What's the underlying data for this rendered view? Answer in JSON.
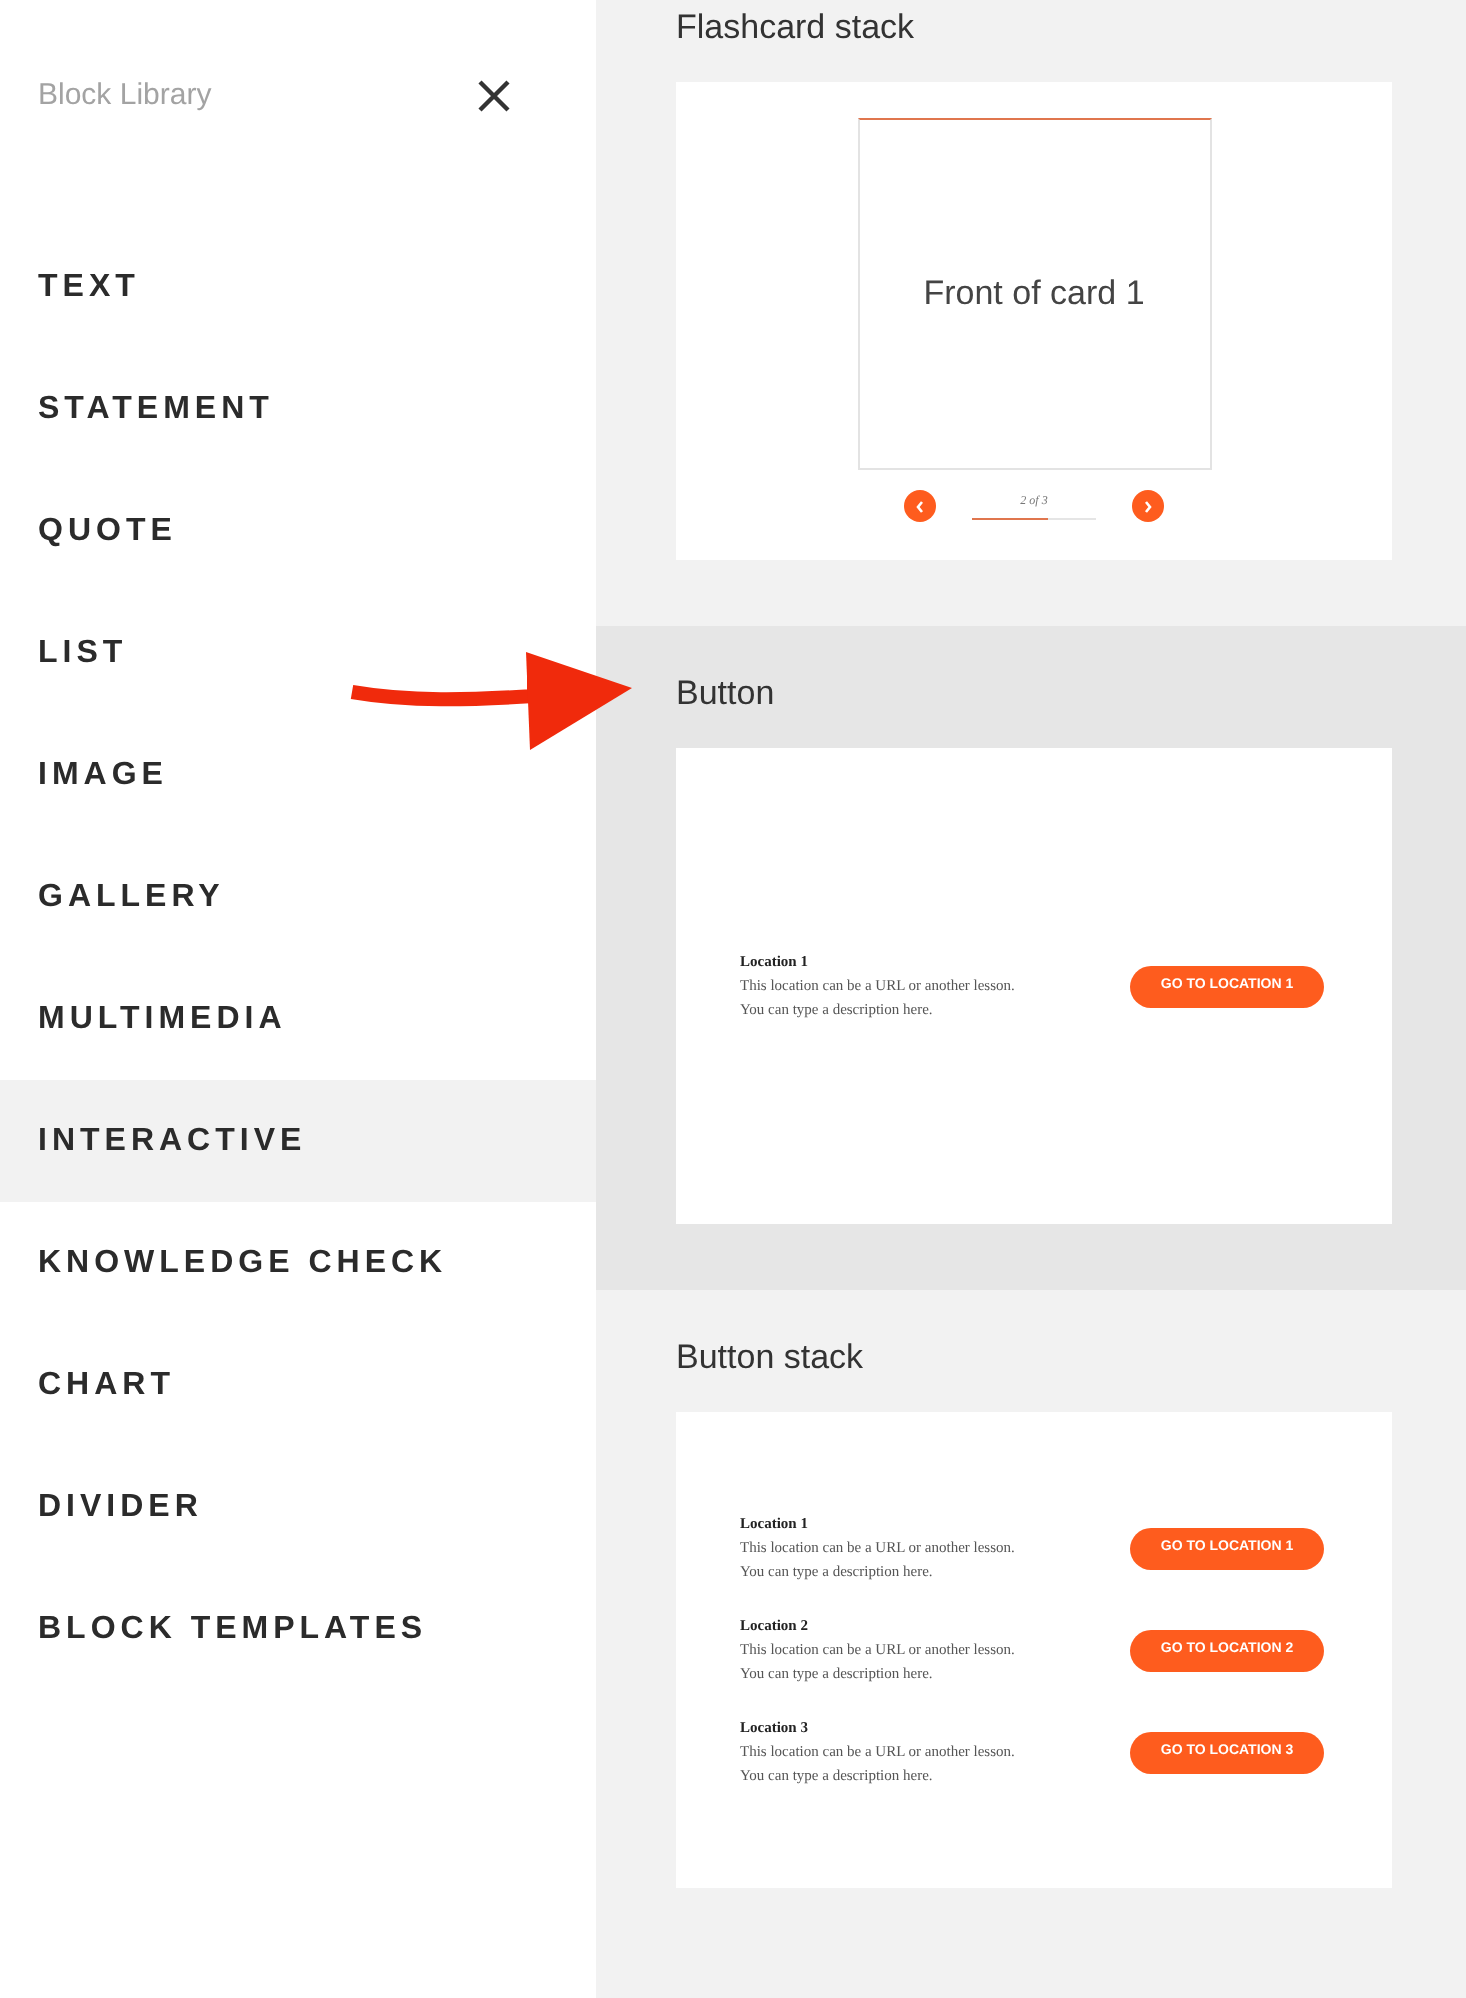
{
  "sidebar": {
    "title": "Block Library",
    "items": [
      {
        "label": "TEXT",
        "selected": false
      },
      {
        "label": "STATEMENT",
        "selected": false
      },
      {
        "label": "QUOTE",
        "selected": false
      },
      {
        "label": "LIST",
        "selected": false
      },
      {
        "label": "IMAGE",
        "selected": false
      },
      {
        "label": "GALLERY",
        "selected": false
      },
      {
        "label": "MULTIMEDIA",
        "selected": false
      },
      {
        "label": "INTERACTIVE",
        "selected": true
      },
      {
        "label": "KNOWLEDGE CHECK",
        "selected": false
      },
      {
        "label": "CHART",
        "selected": false
      },
      {
        "label": "DIVIDER",
        "selected": false
      },
      {
        "label": "BLOCK TEMPLATES",
        "selected": false
      }
    ]
  },
  "blocks": [
    {
      "kind": "flashcard",
      "title": "Flashcard stack",
      "selected": false,
      "card_text": "Front of card 1",
      "pager": "2 of 3",
      "level": 0.62
    },
    {
      "kind": "buttons",
      "title": "Button",
      "selected": true,
      "rows": [
        {
          "heading": "Location 1",
          "lines": [
            "This location can be a URL or another lesson.",
            "You can type a description here."
          ],
          "button": "GO TO LOCATION 1"
        }
      ]
    },
    {
      "kind": "buttons",
      "title": "Button stack",
      "selected": false,
      "rows": [
        {
          "heading": "Location 1",
          "lines": [
            "This location can be a URL or another lesson.",
            "You can type a description here."
          ],
          "button": "GO TO LOCATION 1"
        },
        {
          "heading": "Location 2",
          "lines": [
            "This location can be a URL or another lesson.",
            "You can type a description here."
          ],
          "button": "GO TO LOCATION 2"
        },
        {
          "heading": "Location 3",
          "lines": [
            "This location can be a URL or another lesson.",
            "You can type a description here."
          ],
          "button": "GO TO LOCATION 3"
        }
      ]
    }
  ]
}
